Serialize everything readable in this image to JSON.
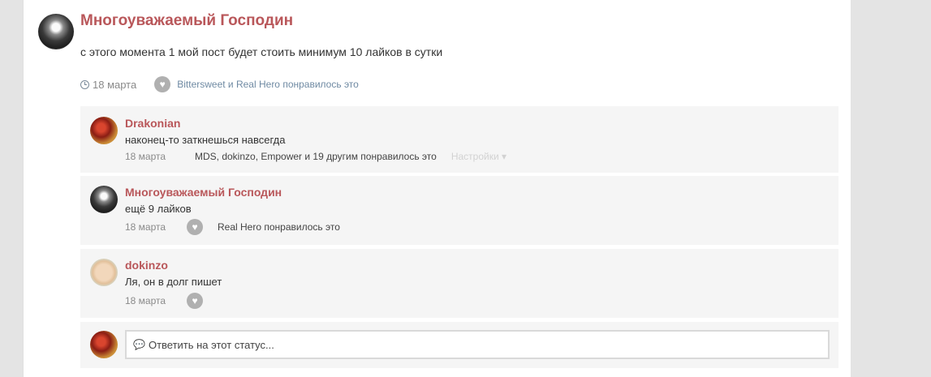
{
  "status": {
    "author": "Многоуважаемый Господин",
    "text": "с этого момента 1 мой пост будет стоить минимум 10 лайков в сутки",
    "date": "18 марта",
    "likes": "Bittersweet и Real Hero понравилось это",
    "heart_icon": "heart-icon",
    "clock_icon": "clock-icon"
  },
  "comments": [
    {
      "author": "Drakonian",
      "text": "наконец-то заткнешься навсегда",
      "date": "18 марта",
      "likes": "MDS, dokinzo, Empower и 19 другим понравилось это",
      "settings": "Настройки ▾"
    },
    {
      "author": "Многоуважаемый Господин",
      "text": "ещё 9 лайков",
      "date": "18 марта",
      "likes": "Real Hero понравилось это"
    },
    {
      "author": "dokinzo",
      "text": "Ля, он в долг пишет",
      "date": "18 марта",
      "likes": ""
    }
  ],
  "reply": {
    "placeholder": "Ответить на этот статус...",
    "icon": "comment-bubble-icon"
  },
  "colors": {
    "accent": "#b9575a",
    "background": "#e4e4e4",
    "comment_bg": "#f5f5f5",
    "link": "#6f8aa3"
  }
}
